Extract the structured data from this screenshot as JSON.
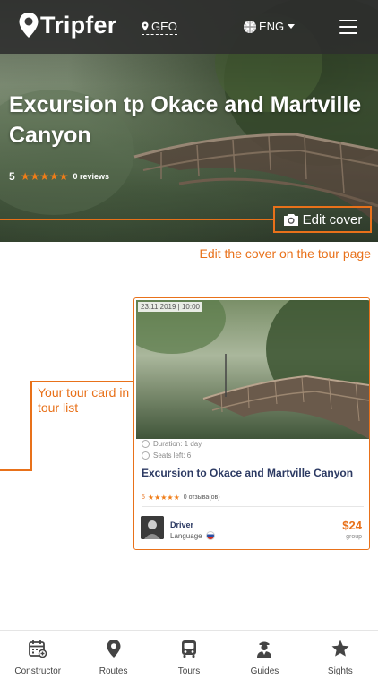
{
  "header": {
    "logo_text": "Tripfer",
    "geo_label": "GEO",
    "language_label": "ENG"
  },
  "hero": {
    "title": "Excursion tp Okace and Martville Canyon",
    "rating": "5",
    "reviews": "0 reviews",
    "edit_cover_label": "Edit cover",
    "cover_note": "Edit the cover on the tour page"
  },
  "callout": {
    "text": "Your tour card in tour list"
  },
  "card": {
    "date": "23.11.2019 | 10:00",
    "duration": "Duration: 1 day",
    "seats": "Seats left: 6",
    "title": "Excursion to Okace and Martville Canyon",
    "rating": "5",
    "reviews": "0 отзыва(ов)",
    "guide_name": "Driver",
    "guide_language": "Language",
    "price": "$24",
    "price_unit": "group"
  },
  "bottom_nav": [
    {
      "label": "Constructor",
      "icon": "calendar-icon"
    },
    {
      "label": "Routes",
      "icon": "map-pin-icon"
    },
    {
      "label": "Tours",
      "icon": "bus-icon"
    },
    {
      "label": "Guides",
      "icon": "guide-icon"
    },
    {
      "label": "Sights",
      "icon": "star-icon"
    }
  ],
  "colors": {
    "accent": "#e8711a",
    "title_blue": "#2c3a63",
    "header_bg": "#2d2d2d"
  }
}
